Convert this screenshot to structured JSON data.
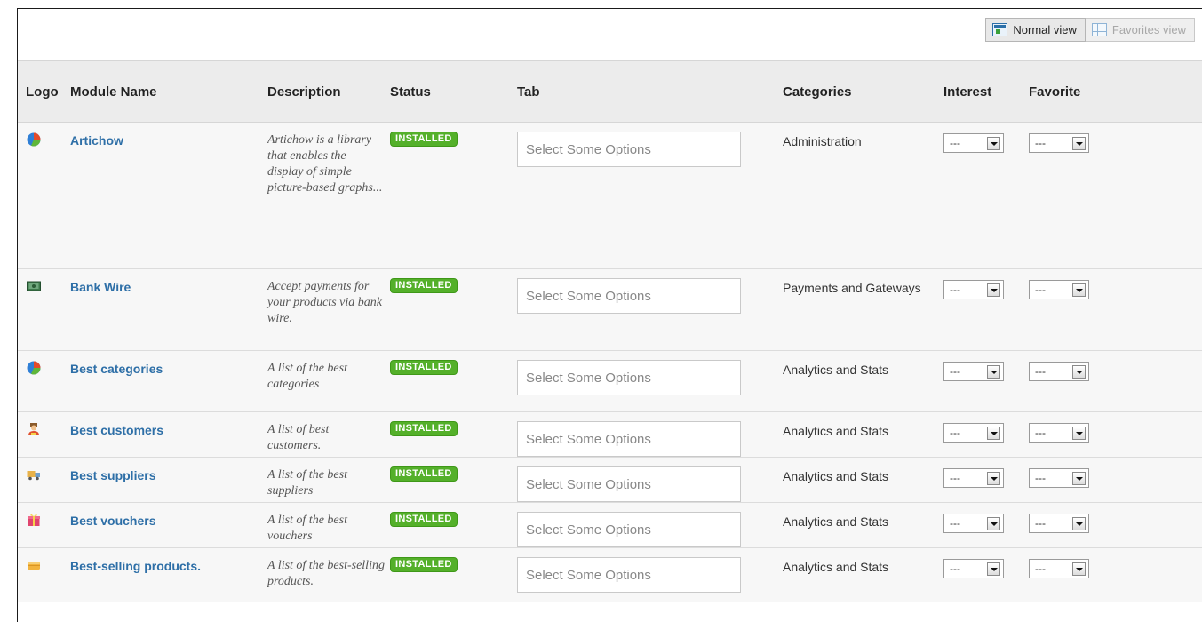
{
  "view_buttons": {
    "normal": "Normal view",
    "favorites": "Favorites view"
  },
  "columns": {
    "logo": "Logo",
    "name": "Module Name",
    "description": "Description",
    "status": "Status",
    "tab": "Tab",
    "categories": "Categories",
    "interest": "Interest",
    "favorite": "Favorite"
  },
  "rows": [
    {
      "icon": "pie-chart-icon",
      "name": "Artichow",
      "description": "Artichow is a library that enables the display of simple picture-based graphs...",
      "status": "INSTALLED",
      "tab_placeholder": "Select Some Options",
      "category": "Administration",
      "interest": "---",
      "favorite": "---"
    },
    {
      "icon": "money-bill-icon",
      "name": "Bank Wire",
      "description": "Accept payments for your products via bank wire.",
      "status": "INSTALLED",
      "tab_placeholder": "Select Some Options",
      "category": "Payments and Gateways",
      "interest": "---",
      "favorite": "---"
    },
    {
      "icon": "pie-chart-icon",
      "name": "Best categories",
      "description": "A list of the best categories",
      "status": "INSTALLED",
      "tab_placeholder": "Select Some Options",
      "category": "Analytics and Stats",
      "interest": "---",
      "favorite": "---"
    },
    {
      "icon": "customer-icon",
      "name": "Best customers",
      "description": "A list of best customers.",
      "status": "INSTALLED",
      "tab_placeholder": "Select Some Options",
      "category": "Analytics and Stats",
      "interest": "---",
      "favorite": "---"
    },
    {
      "icon": "delivery-truck-icon",
      "name": "Best suppliers",
      "description": "A list of the best suppliers",
      "status": "INSTALLED",
      "tab_placeholder": "Select Some Options",
      "category": "Analytics and Stats",
      "interest": "---",
      "favorite": "---"
    },
    {
      "icon": "gift-icon",
      "name": "Best vouchers",
      "description": "A list of the best vouchers",
      "status": "INSTALLED",
      "tab_placeholder": "Select Some Options",
      "category": "Analytics and Stats",
      "interest": "---",
      "favorite": "---"
    },
    {
      "icon": "box-icon",
      "name": "Best-selling products.",
      "description": "A list of the best-selling products.",
      "status": "INSTALLED",
      "tab_placeholder": "Select Some Options",
      "category": "Analytics and Stats",
      "interest": "---",
      "favorite": "---"
    }
  ]
}
